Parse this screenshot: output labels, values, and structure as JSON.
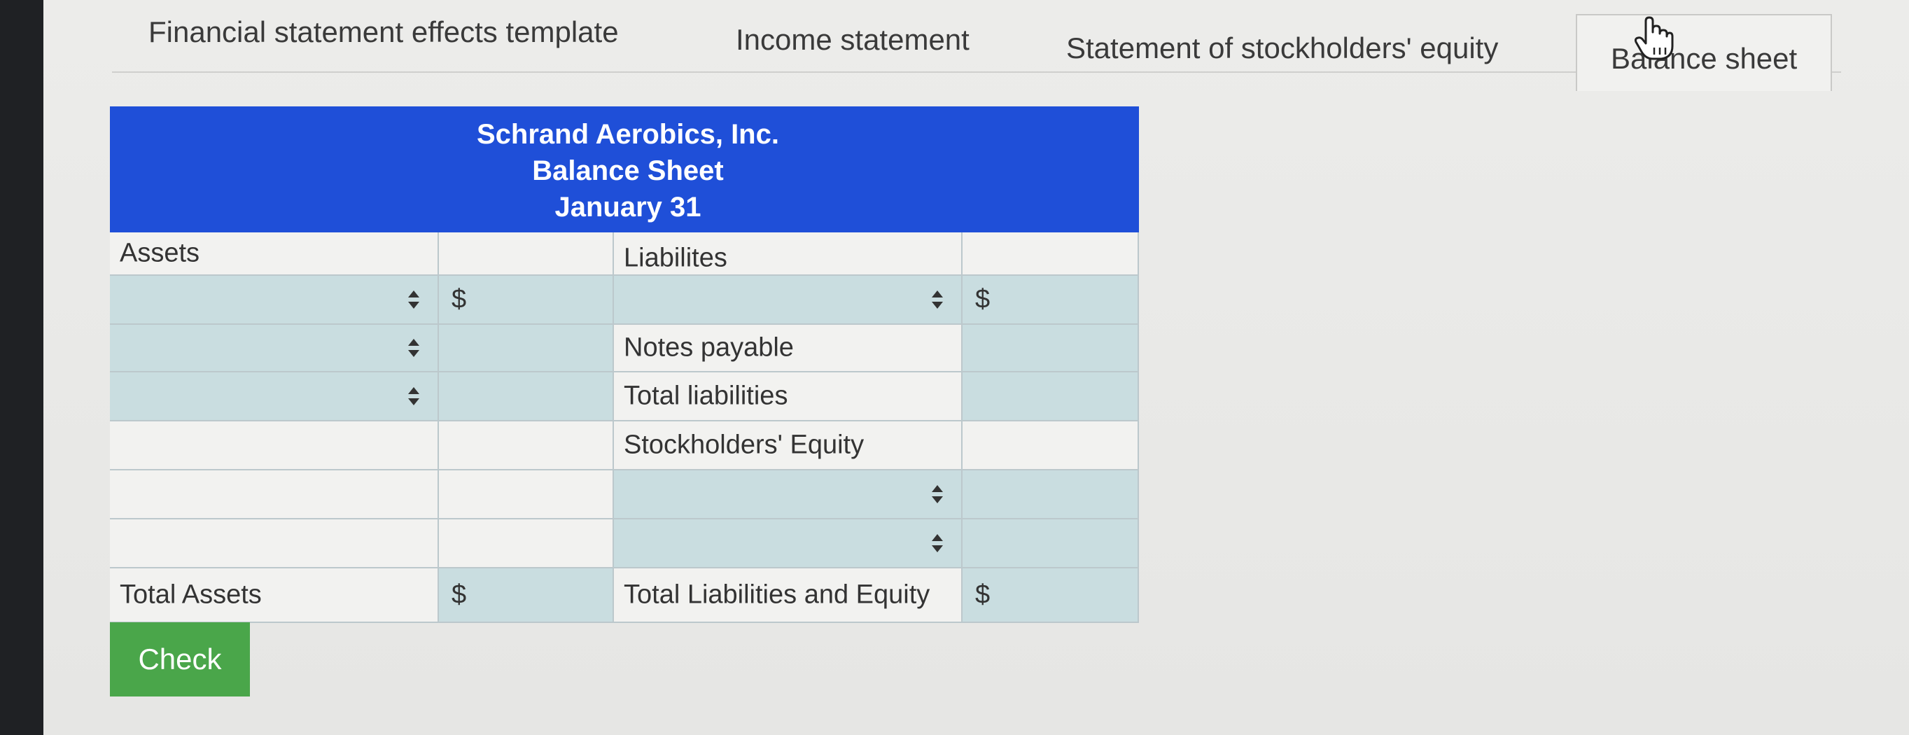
{
  "tabs": [
    {
      "label": "Financial statement effects template",
      "active": false
    },
    {
      "label": "Income statement",
      "active": false
    },
    {
      "label": "Statement of stockholders' equity",
      "active": false
    },
    {
      "label": "Balance sheet",
      "active": true
    }
  ],
  "sheet": {
    "company": "Schrand Aerobics, Inc.",
    "statement": "Balance Sheet",
    "date": "January 31",
    "assets_header": "Assets",
    "liabilities_header": "Liabilites",
    "notes_payable": "Notes payable",
    "total_liabilities": "Total liabilities",
    "stockholders_equity": "Stockholders' Equity",
    "total_assets": "Total Assets",
    "total_liabilities_and_equity": "Total Liabilities and Equity",
    "currency_symbol": "$"
  },
  "actions": {
    "check_label": "Check"
  },
  "colors": {
    "header_blue": "#1f4fd8",
    "input_blue": "#c9dde0",
    "check_green": "#4aa64a"
  },
  "icons": [
    "stepper-icon",
    "hand-pointer-icon"
  ]
}
